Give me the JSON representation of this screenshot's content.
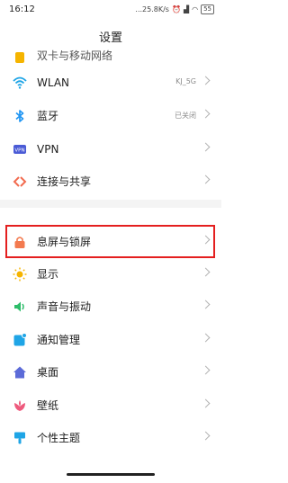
{
  "status": {
    "time": "16:12",
    "network": "...25.8K/s",
    "battery": "55"
  },
  "header": {
    "title": "设置"
  },
  "items": [
    {
      "label": "双卡与移动网络",
      "value": "",
      "icon": "sim-icon"
    },
    {
      "label": "WLAN",
      "value": "KJ_5G",
      "icon": "wifi-icon"
    },
    {
      "label": "蓝牙",
      "value": "已关闭",
      "icon": "bluetooth-icon"
    },
    {
      "label": "VPN",
      "value": "",
      "icon": "vpn-icon"
    },
    {
      "label": "连接与共享",
      "value": "",
      "icon": "share-icon"
    },
    {
      "label": "息屏与锁屏",
      "value": "",
      "icon": "lock-icon"
    },
    {
      "label": "显示",
      "value": "",
      "icon": "brightness-icon"
    },
    {
      "label": "声音与振动",
      "value": "",
      "icon": "sound-icon"
    },
    {
      "label": "通知管理",
      "value": "",
      "icon": "notification-icon"
    },
    {
      "label": "桌面",
      "value": "",
      "icon": "home-icon"
    },
    {
      "label": "壁纸",
      "value": "",
      "icon": "wallpaper-icon"
    },
    {
      "label": "个性主题",
      "value": "",
      "icon": "theme-icon"
    }
  ],
  "colors": {
    "highlight": "#e41f1f"
  }
}
